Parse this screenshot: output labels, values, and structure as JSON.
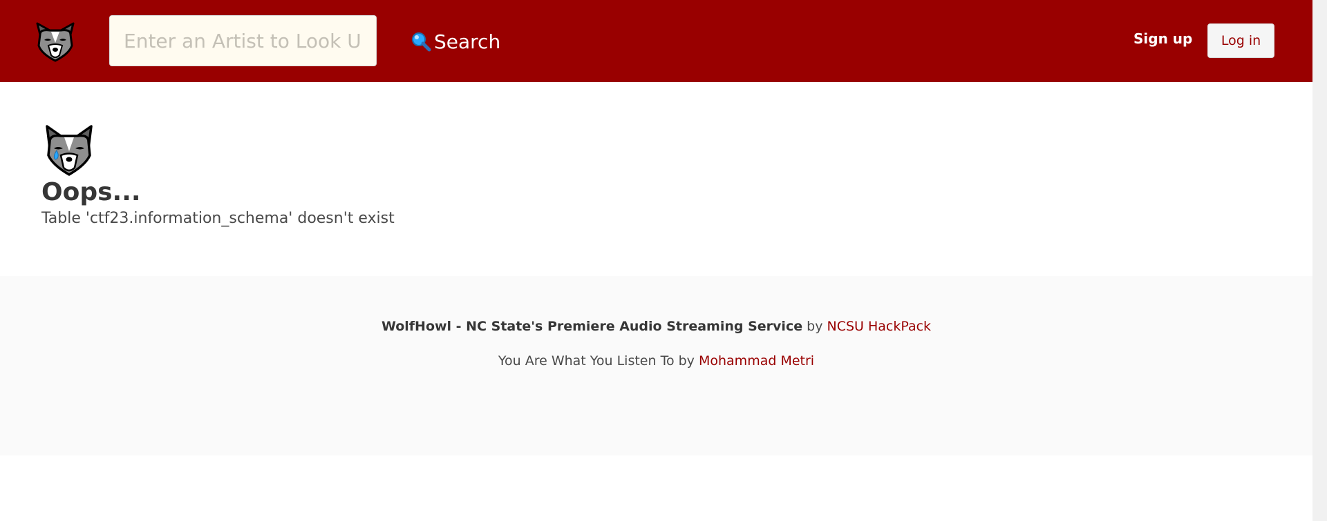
{
  "navbar": {
    "logo_icon": "wolf-face-icon",
    "search": {
      "placeholder": "Enter an Artist to Look Up",
      "value": ""
    },
    "search_button": {
      "icon": "magnifying-glass-icon",
      "label": "Search"
    },
    "signup_label": "Sign up",
    "login_label": "Log in"
  },
  "main": {
    "icon": "crying-wolf-icon",
    "title": "Oops...",
    "message": "Table 'ctf23.information_schema' doesn't exist"
  },
  "footer": {
    "service_name": "WolfHowl - NC State's Premiere Audio Streaming Service",
    "by1": "by",
    "org_link": "NCSU HackPack",
    "tagline": "You Are What You Listen To",
    "by2": "by",
    "author_link": "Mohammad Metri"
  },
  "colors": {
    "brand": "#990000",
    "footer_bg": "#fafafa",
    "link": "#990000"
  }
}
